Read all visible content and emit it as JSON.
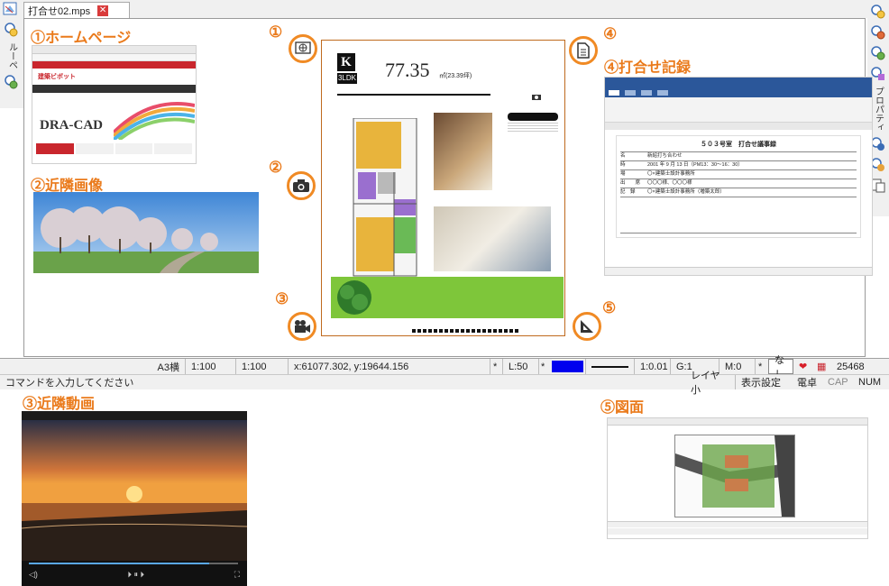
{
  "tab": {
    "title": "打合せ02.mps"
  },
  "left_sidebar": {
    "tab_label": "ルーペ"
  },
  "right_sidebar": {
    "tab_label": "プロパティ"
  },
  "callouts": {
    "c1": {
      "num": "①",
      "heading": "ホームページ"
    },
    "c2": {
      "num": "②",
      "heading": "近隣画像"
    },
    "c3": {
      "num": "③",
      "heading": "近隣動画"
    },
    "c4": {
      "num": "④",
      "heading": "打合せ記録"
    },
    "c5": {
      "num": "⑤",
      "heading": "図面"
    }
  },
  "homepage_thumb": {
    "site_name": "建築ビボット",
    "brand": "DRA-CAD"
  },
  "floorplan": {
    "size_value": "77.35",
    "size_unit": "㎡(23.39坪)",
    "layout_type": "3LDK"
  },
  "doc_thumb": {
    "title": "５０３号室　打合せ議事録",
    "rows": [
      {
        "label": "名",
        "value": "新紹打ち合わせ"
      },
      {
        "label": "時",
        "value": "2001 年 9 月 13 日（PM13：30～16：30）"
      },
      {
        "label": "場",
        "value": "〇×建築士設計事務所"
      },
      {
        "label": "出　　席",
        "value": "〇〇〇様、〇〇〇様"
      },
      {
        "label": "記　録",
        "value": "〇×建築士設計事務所（増築太郎）"
      }
    ]
  },
  "status_bar": {
    "paper": "A3横",
    "scale1": "1:100",
    "scale2": "1:100",
    "coords": "x:61077.302, y:19644.156",
    "star1": "*",
    "layer_L": "L:50",
    "star2": "*",
    "line_scale": "1:0.01",
    "group": "G:1",
    "mode": "M:0",
    "star3": "*",
    "none": "なし",
    "count": "25468",
    "color_swatch": "#0000ee"
  },
  "command_bar": {
    "prompt": "コマンドを入力してください",
    "layer": "レイヤ小",
    "display": "表示設定",
    "calc": "電卓",
    "cap": "CAP",
    "num": "NUM"
  }
}
